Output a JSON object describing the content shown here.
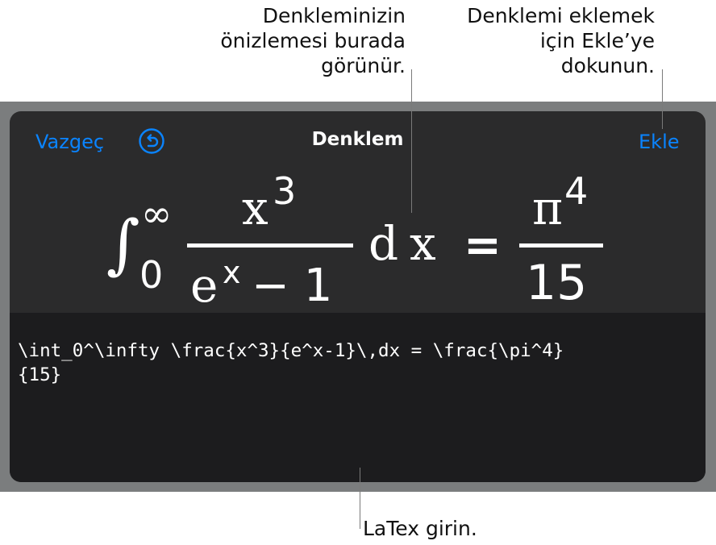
{
  "callouts": {
    "preview": "Denkleminizin\nönizlemesi burada\ngörünür.",
    "insert": "Denklemi eklemek\niçin Ekle’ye\ndokunun.",
    "latex": "LaTex girin."
  },
  "toolbar": {
    "cancel_label": "Vazgeç",
    "title": "Denklem",
    "insert_label": "Ekle"
  },
  "preview": {
    "integral_symbol": "∫",
    "upper_limit": "∞",
    "lower_limit": "0",
    "numerator_base": "x",
    "numerator_exponent": "3",
    "denominator_base": "e",
    "denominator_exponent": "x",
    "denominator_rest": "− 1",
    "differential_d": "d",
    "differential_x": "x",
    "equals": "=",
    "rhs_numerator_base": "π",
    "rhs_numerator_exponent": "4",
    "rhs_denominator": "15"
  },
  "editor": {
    "latex": "\\int_0^\\infty \\frac{x^3}{e^x-1}\\,dx = \\frac{\\pi^4}\n{15}"
  },
  "colors": {
    "accent": "#0a84ff",
    "panel": "#2b2b2c",
    "editor": "#1c1c1e",
    "frame": "#7b7d7e"
  }
}
